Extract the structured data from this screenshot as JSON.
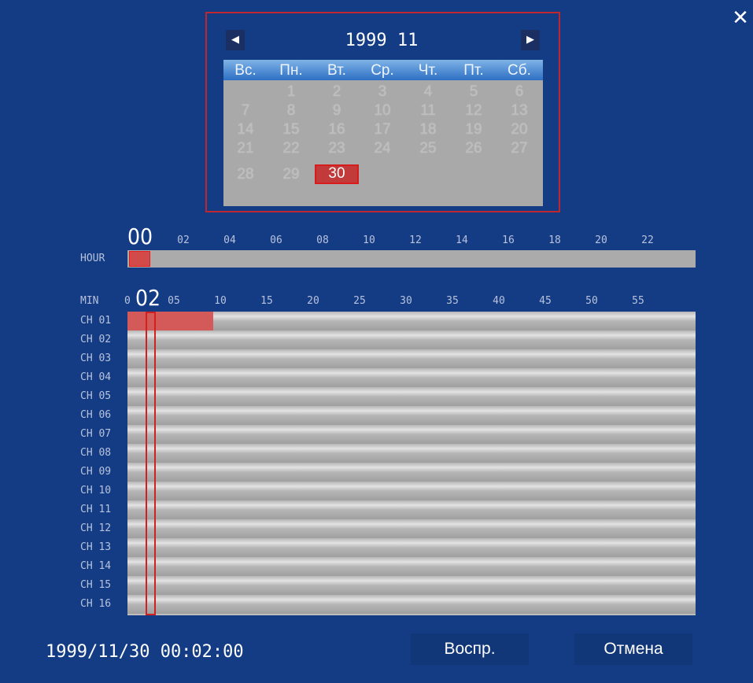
{
  "dialog": {
    "close_icon": "close-icon",
    "calendar": {
      "title": "1999 11",
      "prev_icon": "triangle-left-icon",
      "next_icon": "triangle-right-icon",
      "weekdays": [
        "Вс.",
        "Пн.",
        "Вт.",
        "Ср.",
        "Чт.",
        "Пт.",
        "Сб."
      ],
      "weeks": [
        [
          "",
          "1",
          "2",
          "3",
          "4",
          "5",
          "6"
        ],
        [
          "7",
          "8",
          "9",
          "10",
          "11",
          "12",
          "13"
        ],
        [
          "14",
          "15",
          "16",
          "17",
          "18",
          "19",
          "20"
        ],
        [
          "21",
          "22",
          "23",
          "24",
          "25",
          "26",
          "27"
        ],
        [
          "28",
          "29",
          "30",
          "",
          "",
          "",
          ""
        ]
      ],
      "selected_day": "30"
    },
    "hour_axis": {
      "label": "HOUR",
      "current": "00",
      "ticks": [
        "02",
        "04",
        "06",
        "08",
        "10",
        "12",
        "14",
        "16",
        "18",
        "20",
        "22"
      ]
    },
    "minute_axis": {
      "label": "MIN",
      "current": "02",
      "start_tick_partial": "0",
      "ticks": [
        "05",
        "10",
        "15",
        "20",
        "25",
        "30",
        "35",
        "40",
        "45",
        "50",
        "55"
      ]
    },
    "channels": [
      "CH 01",
      "CH 02",
      "CH 03",
      "CH 04",
      "CH 05",
      "CH 06",
      "CH 07",
      "CH 08",
      "CH 09",
      "CH 10",
      "CH 11",
      "CH 12",
      "CH 13",
      "CH 14",
      "CH 15",
      "CH 16"
    ],
    "status_datetime": "1999/11/30 00:02:00",
    "play_button": "Воспр.",
    "cancel_button": "Отмена",
    "colors": {
      "background": "#143c84",
      "highlight": "#c0262e",
      "track": "#ababab"
    }
  }
}
